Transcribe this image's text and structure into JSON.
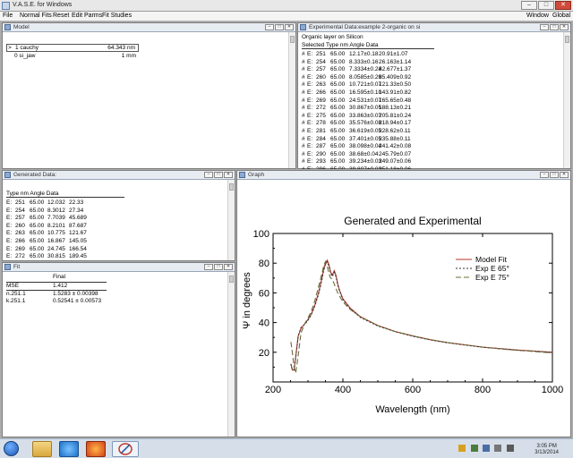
{
  "window": {
    "title": "V.A.S.E. for Windows",
    "buttons": {
      "minimize": "–",
      "maximize": "□",
      "close": "✕"
    }
  },
  "menubar": {
    "left": [
      "File",
      "Normal Fits",
      "Reset",
      "Edit Parms",
      "Fit Studies"
    ],
    "right": [
      "Window",
      "Global"
    ]
  },
  "panel_icons": {
    "minimize": "–",
    "maximize": "□",
    "close": "✕"
  },
  "model_panel": {
    "title": "Model",
    "layers": [
      {
        "marker": ">",
        "name": "1 cauchy",
        "value": "64.343 nm"
      },
      {
        "marker": "",
        "name": "0 si_jaw",
        "value": "1 mm"
      }
    ]
  },
  "experimental_panel": {
    "title": "Experimental Data:example 2-organic on si",
    "subtitle": "Organic layer on Silicon",
    "header": "Selected Type  nm  Angle  Data",
    "rows": [
      {
        "sel": "#",
        "type": "E:",
        "nm": "251",
        "angle": "65.00",
        "psi": "12.17±0.18",
        "delta": "20.91±1.07"
      },
      {
        "sel": "#",
        "type": "E:",
        "nm": "254",
        "angle": "65.00",
        "psi": "8.333±0.16",
        "delta": "26.163±1.14"
      },
      {
        "sel": "#",
        "type": "E:",
        "nm": "257",
        "angle": "65.00",
        "psi": "7.3334±0.28",
        "delta": "42.677±1.37"
      },
      {
        "sel": "#",
        "type": "E:",
        "nm": "260",
        "angle": "65.00",
        "psi": "8.0585±0.29",
        "delta": "85.409±0.92"
      },
      {
        "sel": "#",
        "type": "E:",
        "nm": "263",
        "angle": "65.00",
        "psi": "10.721±0.07",
        "delta": "121.33±0.50"
      },
      {
        "sel": "#",
        "type": "E:",
        "nm": "266",
        "angle": "65.00",
        "psi": "16.595±0.10",
        "delta": "143.91±0.82"
      },
      {
        "sel": "#",
        "type": "E:",
        "nm": "269",
        "angle": "65.00",
        "psi": "24.531±0.07",
        "delta": "165.65±0.48"
      },
      {
        "sel": "#",
        "type": "E:",
        "nm": "272",
        "angle": "65.00",
        "psi": "30.867±0.05",
        "delta": "188.13±0.21"
      },
      {
        "sel": "#",
        "type": "E:",
        "nm": "275",
        "angle": "65.00",
        "psi": "33.863±0.07",
        "delta": "205.81±0.24"
      },
      {
        "sel": "#",
        "type": "E:",
        "nm": "278",
        "angle": "65.00",
        "psi": "35.576±0.08",
        "delta": "218.94±0.17"
      },
      {
        "sel": "#",
        "type": "E:",
        "nm": "281",
        "angle": "65.00",
        "psi": "36.619±0.05",
        "delta": "228.62±0.11"
      },
      {
        "sel": "#",
        "type": "E:",
        "nm": "284",
        "angle": "65.00",
        "psi": "37.401±0.05",
        "delta": "235.88±0.11"
      },
      {
        "sel": "#",
        "type": "E:",
        "nm": "287",
        "angle": "65.00",
        "psi": "38.098±0.04",
        "delta": "241.42±0.08"
      },
      {
        "sel": "#",
        "type": "E:",
        "nm": "290",
        "angle": "65.00",
        "psi": "38.68±0.04",
        "delta": "245.79±0.07"
      },
      {
        "sel": "#",
        "type": "E:",
        "nm": "293",
        "angle": "65.00",
        "psi": "39.234±0.03",
        "delta": "249.07±0.06"
      },
      {
        "sel": "#",
        "type": "E:",
        "nm": "296",
        "angle": "65.00",
        "psi": "39.807±0.03",
        "delta": "251.18±0.06"
      }
    ]
  },
  "generated_panel": {
    "title": "Generated Data:",
    "header": "Type  nm  Angle  Data",
    "rows": [
      {
        "type": "E:",
        "nm": "251",
        "angle": "65.00",
        "psi": "12.032",
        "delta": "22.33"
      },
      {
        "type": "E:",
        "nm": "254",
        "angle": "65.00",
        "psi": "8.3012",
        "delta": "27.34"
      },
      {
        "type": "E:",
        "nm": "257",
        "angle": "65.00",
        "psi": "7.7039",
        "delta": "45.689"
      },
      {
        "type": "E:",
        "nm": "260",
        "angle": "65.00",
        "psi": "8.2101",
        "delta": "87.687"
      },
      {
        "type": "E:",
        "nm": "263",
        "angle": "65.00",
        "psi": "10.775",
        "delta": "121.67"
      },
      {
        "type": "E:",
        "nm": "266",
        "angle": "65.00",
        "psi": "16.867",
        "delta": "145.05"
      },
      {
        "type": "E:",
        "nm": "269",
        "angle": "65.00",
        "psi": "24.745",
        "delta": "166.54"
      },
      {
        "type": "E:",
        "nm": "272",
        "angle": "65.00",
        "psi": "30.815",
        "delta": "189.45"
      }
    ]
  },
  "fit_panel": {
    "title": "Fit",
    "col_header": "Final",
    "rows": [
      {
        "name": "MSE",
        "value": "1.412"
      },
      {
        "name": "n.251.1",
        "value": "1.5283 ± 0.00398"
      },
      {
        "name": "k.251.1",
        "value": "0.52541 ± 0.00573"
      }
    ]
  },
  "graph_panel": {
    "title": "Graph"
  },
  "chart_data": {
    "type": "line",
    "title": "Generated and Experimental",
    "xlabel": "Wavelength (nm)",
    "ylabel": "Ψ in degrees",
    "xlim": [
      200,
      1000
    ],
    "ylim": [
      0,
      100
    ],
    "xticks": [
      200,
      400,
      600,
      800,
      1000
    ],
    "yticks": [
      20,
      40,
      60,
      80,
      100
    ],
    "grid": false,
    "legend_position": "top-right",
    "series": [
      {
        "name": "Model Fit",
        "style": "solid",
        "color": "#b3342b",
        "x": [
          251,
          255,
          260,
          265,
          272,
          280,
          290,
          300,
          310,
          320,
          330,
          340,
          345,
          350,
          355,
          360,
          365,
          370,
          375,
          380,
          385,
          390,
          400,
          420,
          450,
          500,
          550,
          600,
          650,
          700,
          750,
          800,
          850,
          900,
          950,
          1000
        ],
        "y": [
          12,
          8,
          8,
          17,
          31,
          36,
          39,
          42,
          46,
          52,
          60,
          70,
          76,
          80,
          82,
          79,
          74,
          72,
          75,
          72,
          66,
          62,
          56,
          50,
          44,
          38,
          34,
          31,
          28.5,
          26.5,
          25,
          23.5,
          22.5,
          21.5,
          20.8,
          20
        ]
      },
      {
        "name": "Exp E 65°",
        "style": "short-dash",
        "color": "#333333",
        "x": [
          251,
          255,
          260,
          265,
          272,
          280,
          290,
          300,
          310,
          320,
          330,
          340,
          345,
          350,
          355,
          360,
          365,
          370,
          375,
          380,
          385,
          390,
          400,
          420,
          450,
          500,
          550,
          600,
          650,
          700,
          750,
          800,
          850,
          900,
          950,
          1000
        ],
        "y": [
          12.2,
          8.3,
          8.1,
          16.6,
          30.9,
          36.6,
          38.7,
          41.5,
          45.5,
          51.5,
          59,
          69,
          75,
          79,
          81,
          78,
          73,
          71,
          74,
          71,
          65.5,
          61.5,
          55.5,
          49.5,
          43.5,
          37.7,
          33.8,
          30.8,
          28.3,
          26.4,
          24.8,
          23.4,
          22.4,
          21.4,
          20.7,
          20
        ]
      },
      {
        "name": "Exp E 75°",
        "style": "long-dash",
        "color": "#6b6b3a",
        "x": [
          251,
          255,
          260,
          265,
          272,
          280,
          290,
          300,
          310,
          320,
          330,
          340,
          345,
          350,
          355,
          360,
          365,
          370,
          375,
          380,
          385,
          390,
          400,
          420,
          450,
          500,
          550,
          600,
          650,
          700,
          750,
          800,
          850,
          900,
          950,
          1000
        ],
        "y": [
          27,
          20,
          10,
          6,
          18,
          33,
          39,
          43,
          48,
          55,
          64,
          73,
          78,
          81,
          78,
          73,
          70,
          69,
          66,
          63,
          60,
          58,
          54,
          49,
          44,
          38,
          34,
          31,
          28.5,
          26.5,
          25,
          23.5,
          22.3,
          21.3,
          20.5,
          19.5
        ]
      }
    ]
  },
  "taskbar": {
    "icons": [
      "start-orb",
      "file-explorer-icon",
      "internet-explorer-icon",
      "firefox-icon",
      "vase-app-icon"
    ],
    "clock_time": "3:05 PM",
    "clock_date": "3/13/2014"
  }
}
